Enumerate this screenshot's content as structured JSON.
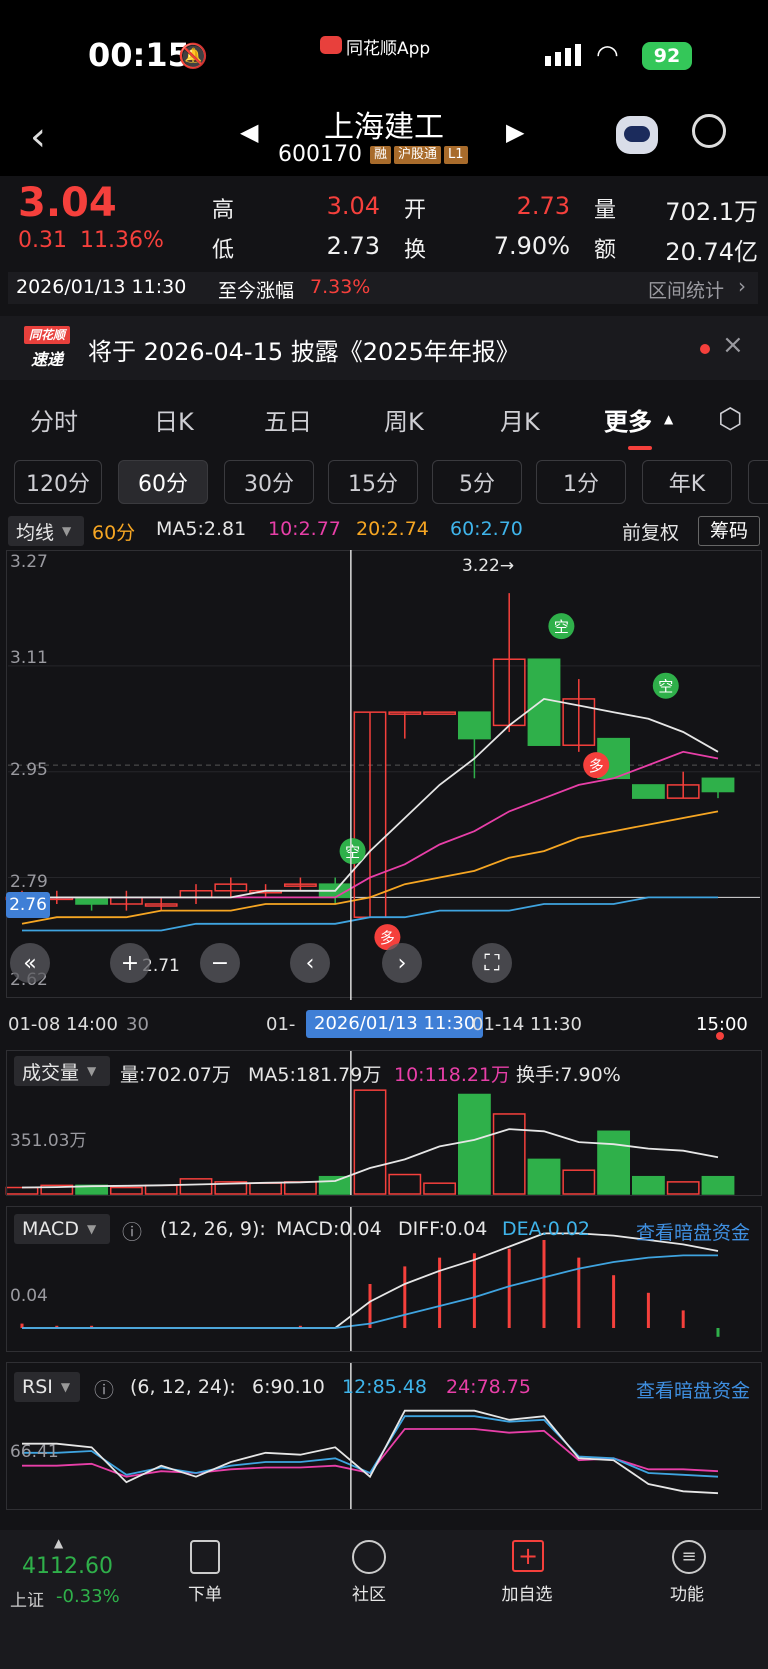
{
  "status": {
    "time": "00:15",
    "source_app": "同花顺App",
    "battery": "92"
  },
  "header": {
    "name": "上海建工",
    "code": "600170",
    "tags": [
      "融",
      "沪股通",
      "L1"
    ]
  },
  "quote": {
    "price": "3.04",
    "change": "0.31",
    "change_pct": "11.36%",
    "high_label": "高",
    "high": "3.04",
    "open_label": "开",
    "open": "2.73",
    "vol_label": "量",
    "vol": "702.1万",
    "low_label": "低",
    "low": "2.73",
    "turn_label": "换",
    "turn": "7.90%",
    "amount_label": "额",
    "amount": "20.74亿",
    "datetime": "2026/01/13 11:30",
    "since_label": "至今涨幅",
    "since": "7.33%",
    "interval_label": "区间统计"
  },
  "notice": {
    "logo_top": "同花顺",
    "logo_bottom": "速递",
    "text": "将于 2026-04-15 披露《2025年年报》"
  },
  "period_tabs": [
    "分时",
    "日K",
    "五日",
    "周K",
    "月K",
    "更多"
  ],
  "chips": [
    "120分",
    "60分",
    "30分",
    "15分",
    "5分",
    "1分",
    "年K"
  ],
  "ma_bar": {
    "type": "均线",
    "period": "60分",
    "ma5": "MA5:2.81",
    "ma10": "10:2.77",
    "ma20": "20:2.74",
    "ma60": "60:2.70",
    "adjust": "前复权",
    "chip_btn": "筹码"
  },
  "kline": {
    "y_labels": [
      "3.27",
      "3.11",
      "2.95",
      "2.79",
      "2.62"
    ],
    "current_tag": "2.76",
    "max_note": "3.22→",
    "min_note": "2.71",
    "x_labels": [
      "01-08 14:00",
      "30",
      "01-",
      "01-14 11:30",
      "15:00"
    ],
    "cursor_date": "2026/01/13 11:30",
    "signals": [
      "空",
      "空",
      "空",
      "多",
      "多"
    ]
  },
  "volume": {
    "type": "成交量",
    "vol": "量:702.07万",
    "ma5": "MA5:181.79万",
    "ma10": "10:118.21万",
    "turn": "换手:7.90%",
    "y_label": "351.03万"
  },
  "macd": {
    "type": "MACD",
    "params": "(12, 26, 9):",
    "macd": "MACD:0.04",
    "diff": "DIFF:0.04",
    "dea": "DEA:0.02",
    "link": "查看暗盘资金",
    "y_label": "0.04"
  },
  "rsi": {
    "type": "RSI",
    "params": "(6, 12, 24):",
    "r6": "6:90.10",
    "r12": "12:85.48",
    "r24": "24:78.75",
    "link": "查看暗盘资金",
    "y_label": "66.41"
  },
  "bottom": {
    "index_value": "4112.60",
    "index_name": "上证",
    "index_change": "-0.33%",
    "nav": [
      "下单",
      "社区",
      "加自选",
      "功能"
    ]
  },
  "chart_data": {
    "type": "candlestick",
    "candles": [
      {
        "o": 2.76,
        "c": 2.76,
        "h": 2.77,
        "l": 2.75
      },
      {
        "o": 2.76,
        "c": 2.76,
        "h": 2.77,
        "l": 2.75
      },
      {
        "o": 2.76,
        "c": 2.75,
        "h": 2.76,
        "l": 2.74
      },
      {
        "o": 2.75,
        "c": 2.76,
        "h": 2.77,
        "l": 2.74
      },
      {
        "o": 2.75,
        "c": 2.75,
        "h": 2.76,
        "l": 2.74
      },
      {
        "o": 2.76,
        "c": 2.77,
        "h": 2.78,
        "l": 2.75
      },
      {
        "o": 2.77,
        "c": 2.78,
        "h": 2.79,
        "l": 2.76
      },
      {
        "o": 2.77,
        "c": 2.77,
        "h": 2.78,
        "l": 2.76
      },
      {
        "o": 2.78,
        "c": 2.78,
        "h": 2.79,
        "l": 2.77
      },
      {
        "o": 2.78,
        "c": 2.76,
        "h": 2.79,
        "l": 2.75
      },
      {
        "o": 2.73,
        "c": 3.04,
        "h": 3.04,
        "l": 2.73
      },
      {
        "o": 3.04,
        "c": 3.04,
        "h": 3.04,
        "l": 3.0
      },
      {
        "o": 3.04,
        "c": 3.04,
        "h": 3.04,
        "l": 3.04
      },
      {
        "o": 3.04,
        "c": 3.0,
        "h": 3.04,
        "l": 2.94
      },
      {
        "o": 3.02,
        "c": 3.12,
        "h": 3.22,
        "l": 3.01
      },
      {
        "o": 3.12,
        "c": 2.99,
        "h": 3.12,
        "l": 2.99
      },
      {
        "o": 2.99,
        "c": 3.06,
        "h": 3.09,
        "l": 2.98
      },
      {
        "o": 3.0,
        "c": 2.94,
        "h": 3.0,
        "l": 2.94
      },
      {
        "o": 2.93,
        "c": 2.91,
        "h": 2.93,
        "l": 2.91
      },
      {
        "o": 2.91,
        "c": 2.93,
        "h": 2.95,
        "l": 2.91
      },
      {
        "o": 2.94,
        "c": 2.92,
        "h": 2.94,
        "l": 2.91
      }
    ],
    "ma5": [
      2.76,
      2.76,
      2.76,
      2.76,
      2.76,
      2.76,
      2.76,
      2.77,
      2.77,
      2.77,
      2.83,
      2.88,
      2.93,
      2.97,
      3.02,
      3.06,
      3.05,
      3.04,
      3.03,
      3.01,
      2.98
    ],
    "ma10": [
      2.76,
      2.76,
      2.76,
      2.76,
      2.76,
      2.76,
      2.76,
      2.76,
      2.76,
      2.76,
      2.79,
      2.81,
      2.84,
      2.86,
      2.89,
      2.91,
      2.93,
      2.94,
      2.96,
      2.98,
      2.97
    ],
    "ma20": [
      2.72,
      2.73,
      2.73,
      2.73,
      2.74,
      2.74,
      2.74,
      2.75,
      2.75,
      2.75,
      2.76,
      2.78,
      2.79,
      2.8,
      2.82,
      2.83,
      2.85,
      2.86,
      2.87,
      2.88,
      2.89
    ],
    "ma60": [
      2.71,
      2.71,
      2.71,
      2.71,
      2.71,
      2.72,
      2.72,
      2.72,
      2.72,
      2.72,
      2.73,
      2.73,
      2.74,
      2.74,
      2.74,
      2.75,
      2.75,
      2.75,
      2.76,
      2.76,
      2.76
    ],
    "volume": [
      15,
      20,
      20,
      15,
      20,
      35,
      28,
      25,
      28,
      40,
      240,
      45,
      25,
      230,
      185,
      80,
      55,
      145,
      40,
      28,
      40
    ],
    "vol_ma": [
      15,
      16,
      18,
      19,
      20,
      22,
      24,
      26,
      27,
      30,
      60,
      80,
      110,
      125,
      150,
      145,
      120,
      115,
      105,
      100,
      85
    ],
    "macd_diff": [
      0.0,
      0.0,
      0.0,
      0.0,
      0.0,
      0.0,
      0.0,
      0.0,
      0.0,
      0.0,
      0.012,
      0.02,
      0.026,
      0.031,
      0.037,
      0.043,
      0.043,
      0.042,
      0.04,
      0.038,
      0.035
    ],
    "macd_dea": [
      0.0,
      0.0,
      0.0,
      0.0,
      0.0,
      0.0,
      0.0,
      0.0,
      0.0,
      0.0,
      0.002,
      0.006,
      0.01,
      0.014,
      0.019,
      0.023,
      0.027,
      0.03,
      0.032,
      0.033,
      0.033
    ],
    "macd_hist": [
      0.002,
      0.001,
      0.001,
      0.0,
      0.0,
      0.0,
      0.0,
      0.0,
      0.001,
      0.0,
      0.02,
      0.028,
      0.032,
      0.034,
      0.036,
      0.04,
      0.032,
      0.024,
      0.016,
      0.008,
      -0.004
    ],
    "rsi6": [
      74,
      74,
      72,
      53,
      62,
      56,
      64,
      69,
      68,
      72,
      56,
      92,
      92,
      92,
      87,
      89,
      66,
      65,
      52,
      48,
      47
    ],
    "rsi12": [
      69,
      69,
      70,
      57,
      61,
      58,
      62,
      64,
      64,
      66,
      58,
      89,
      89,
      89,
      86,
      87,
      67,
      66,
      58,
      57,
      56
    ],
    "rsi24": [
      62,
      62,
      63,
      56,
      59,
      58,
      60,
      61,
      61,
      62,
      58,
      82,
      82,
      82,
      80,
      81,
      65,
      66,
      60,
      60,
      59
    ],
    "rsi_range": [
      40,
      100
    ],
    "y_range": [
      2.62,
      3.27
    ],
    "cursor_index": 10
  }
}
